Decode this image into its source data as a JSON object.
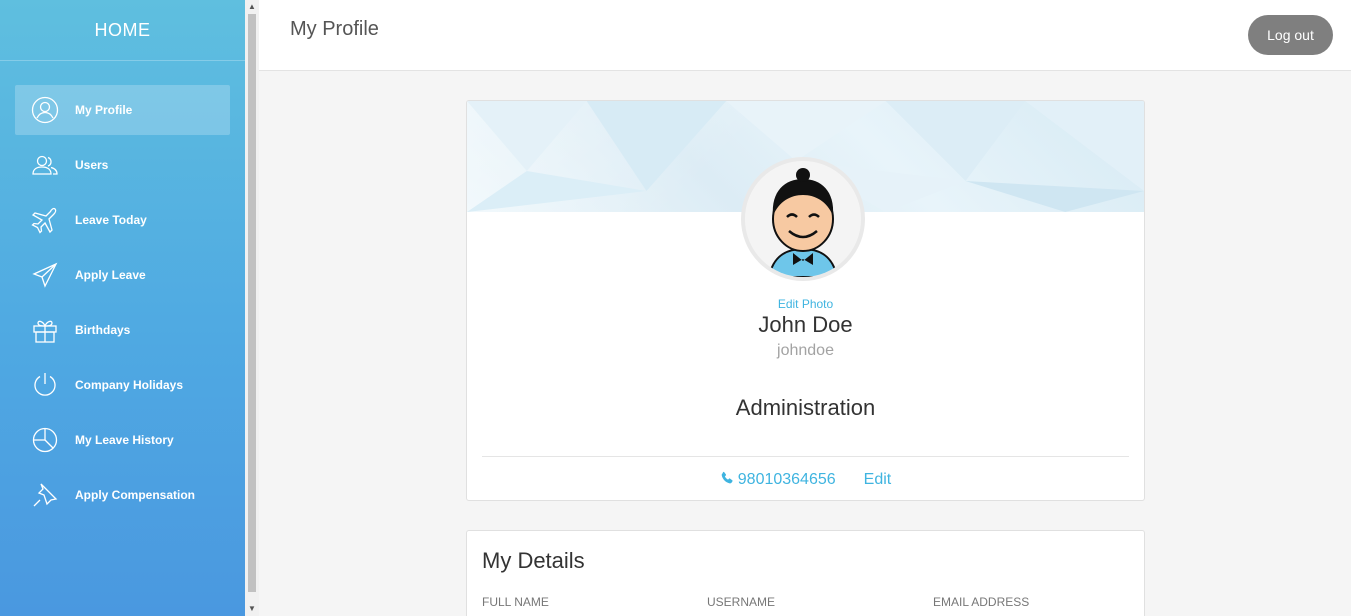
{
  "sidebar": {
    "home_label": "HOME",
    "items": [
      {
        "label": "My Profile",
        "icon": "user-icon",
        "active": true
      },
      {
        "label": "Users",
        "icon": "users-icon",
        "active": false
      },
      {
        "label": "Leave Today",
        "icon": "plane-icon",
        "active": false
      },
      {
        "label": "Apply Leave",
        "icon": "paper-plane-icon",
        "active": false
      },
      {
        "label": "Birthdays",
        "icon": "gift-icon",
        "active": false
      },
      {
        "label": "Company Holidays",
        "icon": "power-icon",
        "active": false
      },
      {
        "label": "My Leave History",
        "icon": "pie-chart-icon",
        "active": false
      },
      {
        "label": "Apply Compensation",
        "icon": "pin-icon",
        "active": false
      }
    ]
  },
  "header": {
    "title": "My Profile",
    "logout_label": "Log out"
  },
  "profile": {
    "edit_photo_label": "Edit Photo",
    "name": "John Doe",
    "username": "johndoe",
    "department": "Administration",
    "phone": "98010364656",
    "edit_label": "Edit"
  },
  "details": {
    "title": "My Details",
    "columns": [
      "FULL NAME",
      "USERNAME",
      "EMAIL ADDRESS"
    ]
  },
  "colors": {
    "accent": "#3fb4e0",
    "sidebar_top": "#5fbfdf",
    "sidebar_bottom": "#4a98e0",
    "logout_bg": "#7f7f7f"
  }
}
